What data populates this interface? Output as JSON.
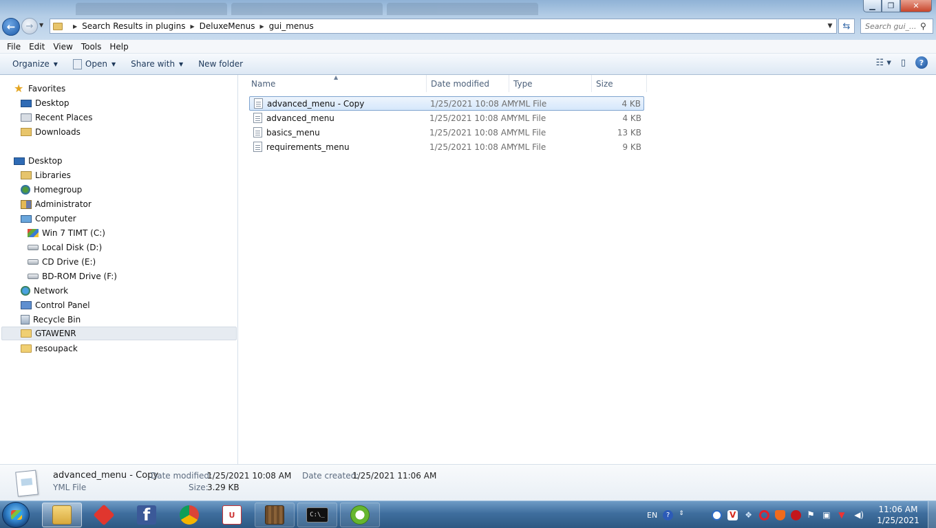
{
  "window": {
    "minimize_label": "▁",
    "maximize_label": "❐",
    "close_label": "✕"
  },
  "address": {
    "crumbs": [
      "Search Results in plugins",
      "DeluxeMenus",
      "gui_menus"
    ],
    "search_placeholder": "Search gui_..."
  },
  "menubar": [
    "File",
    "Edit",
    "View",
    "Tools",
    "Help"
  ],
  "commands": {
    "organize": "Organize",
    "open": "Open",
    "share_with": "Share with",
    "new_folder": "New folder"
  },
  "nav": {
    "favorites": "Favorites",
    "fav_items": [
      "Desktop",
      "Recent Places",
      "Downloads"
    ],
    "desktop": "Desktop",
    "desktop_items": [
      "Libraries",
      "Homegroup",
      "Administrator",
      "Computer"
    ],
    "drives": [
      "Win 7 TIMT (C:)",
      "Local Disk (D:)",
      "CD Drive (E:)",
      "BD-ROM Drive (F:)"
    ],
    "other_items": [
      "Network",
      "Control Panel",
      "Recycle Bin",
      "GTAWENR",
      "resoupack"
    ]
  },
  "columns": {
    "name": "Name",
    "date": "Date modified",
    "type": "Type",
    "size": "Size"
  },
  "files": [
    {
      "name": "advanced_menu - Copy",
      "date": "1/25/2021 10:08 AM",
      "type": "YML File",
      "size": "4 KB"
    },
    {
      "name": "advanced_menu",
      "date": "1/25/2021 10:08 AM",
      "type": "YML File",
      "size": "4 KB"
    },
    {
      "name": "basics_menu",
      "date": "1/25/2021 10:08 AM",
      "type": "YML File",
      "size": "13 KB"
    },
    {
      "name": "requirements_menu",
      "date": "1/25/2021 10:08 AM",
      "type": "YML File",
      "size": "9 KB"
    }
  ],
  "details": {
    "name": "advanced_menu - Copy",
    "type": "YML File",
    "date_modified_label": "Date modified:",
    "date_modified": "1/25/2021 10:08 AM",
    "date_created_label": "Date created:",
    "date_created": "1/25/2021 11:06 AM",
    "size_label": "Size:",
    "size": "3.29 KB"
  },
  "tray": {
    "language": "EN",
    "time": "11:06 AM",
    "date": "1/25/2021"
  },
  "colors": {
    "selection_bg": "#d5e7fb",
    "selection_border": "#7da2ce",
    "taskbar": "#3f6e9e"
  }
}
